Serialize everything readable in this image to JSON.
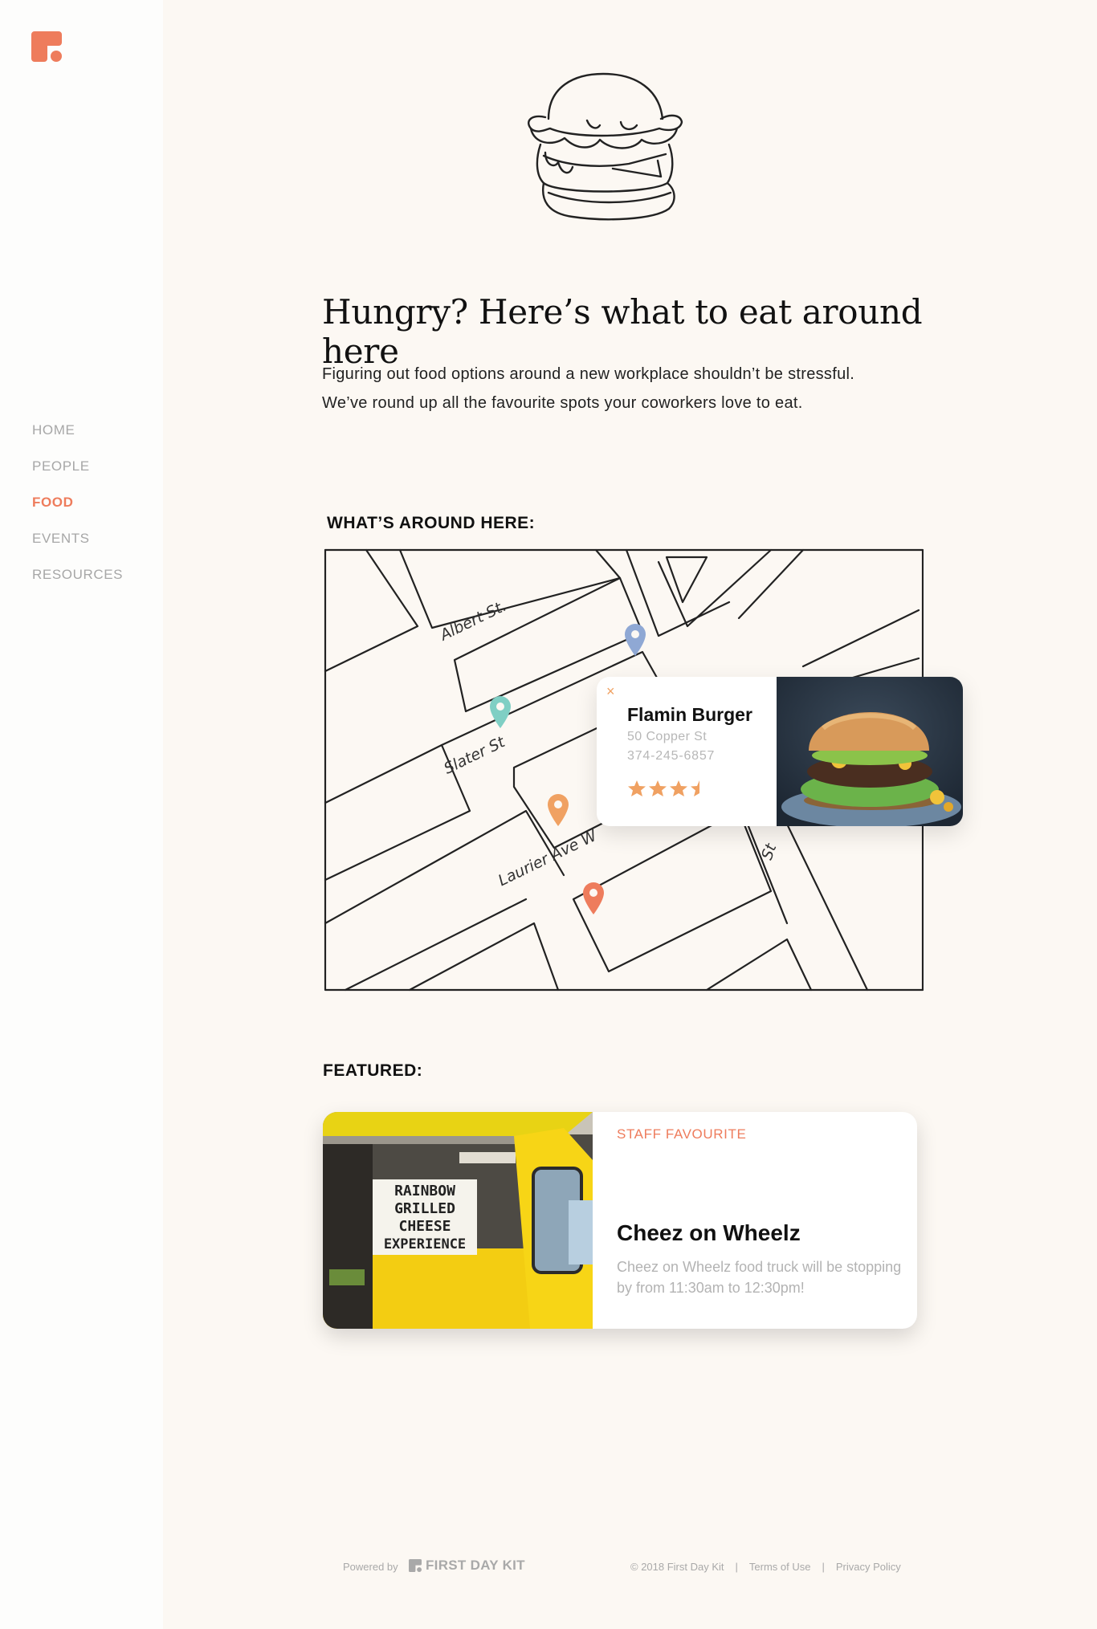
{
  "sidebar": {
    "nav": [
      {
        "label": "HOME",
        "active": false
      },
      {
        "label": "PEOPLE",
        "active": false
      },
      {
        "label": "FOOD",
        "active": true
      },
      {
        "label": "EVENTS",
        "active": false
      },
      {
        "label": "RESOURCES",
        "active": false
      }
    ]
  },
  "hero": {
    "headline": "Hungry? Here’s what to eat around here",
    "intro_line1": "Figuring out food options around a new workplace shouldn’t be stressful.",
    "intro_line2": "We’ve round up all the favourite spots your coworkers love to eat."
  },
  "map": {
    "section_label": "WHAT’S AROUND HERE:",
    "streets": [
      "Albert St.",
      "Slater St",
      "Laurier Ave W",
      "St"
    ],
    "pins": [
      {
        "color": "#8fa8d4"
      },
      {
        "color": "#7fcfc4"
      },
      {
        "color": "#f0a162"
      },
      {
        "color": "#ee7c5c"
      }
    ],
    "popup": {
      "close_icon": "×",
      "name": "Flamin Burger",
      "address": "50 Copper St",
      "phone": "374-245-6857",
      "rating": 3.5,
      "star_color": "#f0a162"
    }
  },
  "featured": {
    "section_label": "FEATURED:",
    "tag": "STAFF FAVOURITE",
    "title": "Cheez on Wheelz",
    "description": "Cheez on Wheelz food truck will be stopping by from 11:30am to 12:30pm!",
    "sign_lines": [
      "RAINBOW",
      "GRILLED",
      "CHEESE",
      "EXPERIENCE"
    ]
  },
  "footer": {
    "powered_by": "Powered by",
    "brand": "FIRST DAY KIT",
    "copyright": "© 2018 First Day Kit",
    "separator": "|",
    "terms": "Terms of Use",
    "privacy": "Privacy Policy"
  },
  "colors": {
    "accent": "#ee7c5c",
    "background": "#fcf8f3",
    "sidebar": "#fdfdfc"
  }
}
